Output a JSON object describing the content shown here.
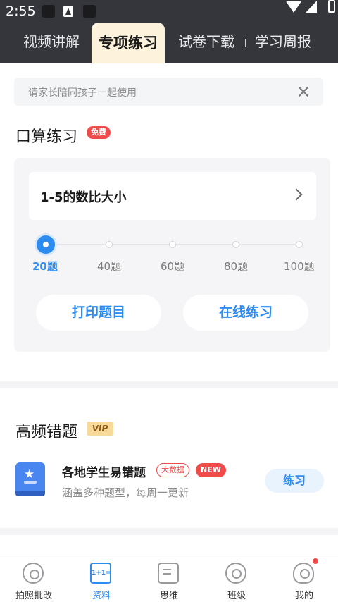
{
  "status_bar": {
    "time": "2:55"
  },
  "top_tabs": [
    {
      "label": "视频讲解"
    },
    {
      "label": "专项练习"
    },
    {
      "label": "试卷下载"
    },
    {
      "label": "学习周报"
    }
  ],
  "active_tab_index": 1,
  "notice": {
    "text": "请家长陪同孩子一起使用"
  },
  "oral_practice": {
    "title": "口算练习",
    "badge": "免费",
    "topic": "1-5的数比大小",
    "question_counts": [
      "20题",
      "40题",
      "60题",
      "80题",
      "100题"
    ],
    "selected_count": "20题",
    "print_label": "打印题目",
    "online_label": "在线练习"
  },
  "frequent_errors": {
    "title": "高频错题",
    "badge": "VIP",
    "item": {
      "title": "各地学生易错题",
      "tag_bigdata": "大数据",
      "tag_new": "NEW",
      "subtitle": "涵盖多种题型，每周一更新",
      "action_label": "练习"
    }
  },
  "bottom_nav": [
    {
      "label": "拍照批改",
      "icon": "camera-icon"
    },
    {
      "label": "资料",
      "icon": "book-icon",
      "icon_text": "1+1="
    },
    {
      "label": "思维",
      "icon": "thinking-icon"
    },
    {
      "label": "班级",
      "icon": "class-icon"
    },
    {
      "label": "我的",
      "icon": "profile-icon"
    }
  ],
  "colors": {
    "accent": "#2d8cf0",
    "header_bg": "#35363c",
    "active_tab_bg": "#fdf3dc",
    "badge_red": "#ef4b4b",
    "vip_gold": "#f7d99a"
  }
}
